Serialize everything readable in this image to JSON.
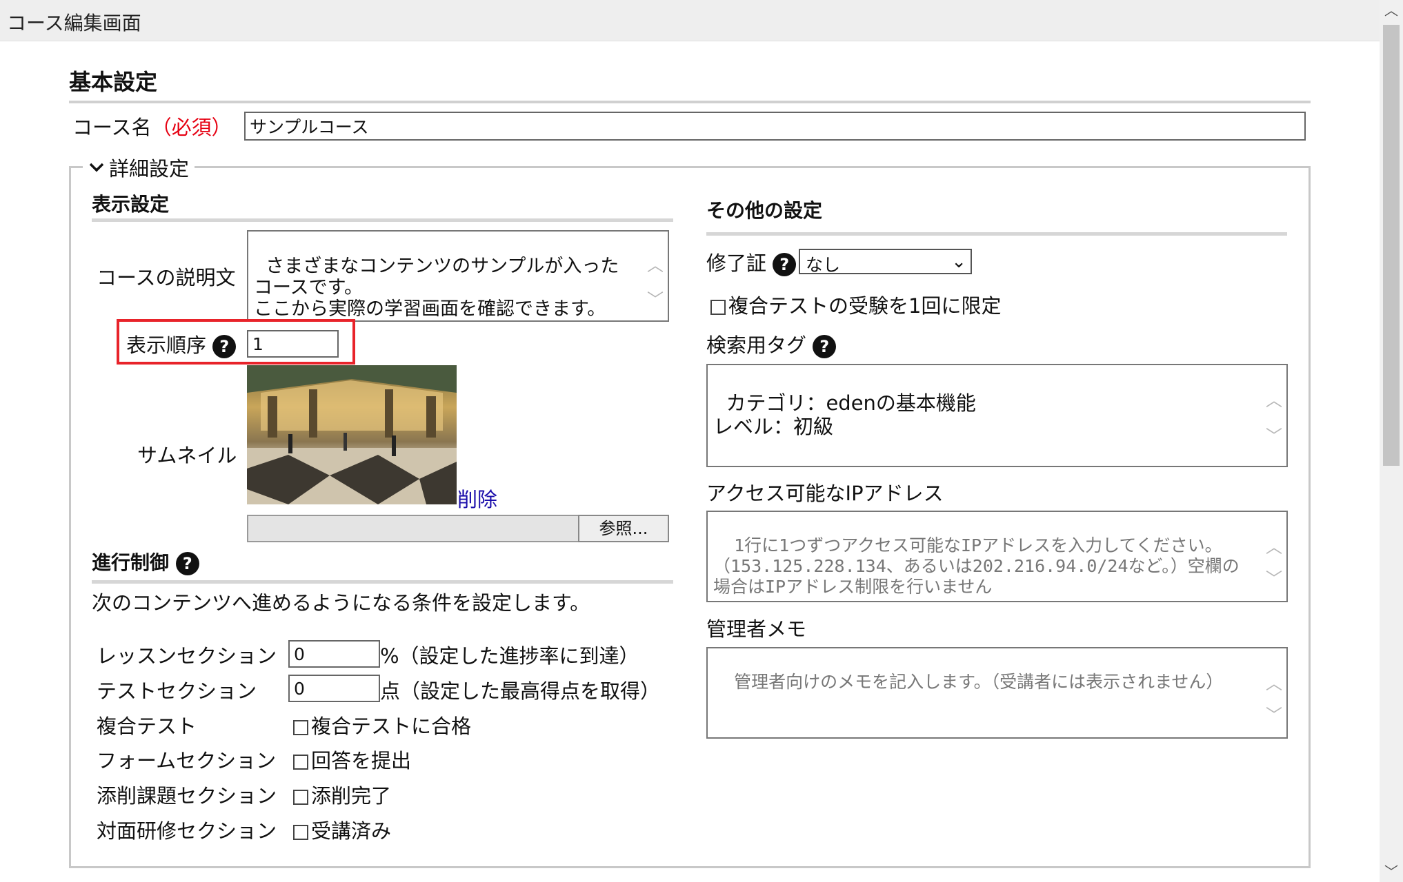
{
  "window": {
    "title": "コース編集画面"
  },
  "basic": {
    "heading": "基本設定",
    "course_name_label": "コース名",
    "required_label": "（必須）",
    "course_name_value": "サンプルコース"
  },
  "details": {
    "legend": "詳細設定",
    "display": {
      "heading": "表示設定",
      "description_label": "コースの説明文",
      "description_value": "さまざまなコンテンツのサンプルが入ったコースです。\nここから実際の学習画面を確認できます。",
      "order_label": "表示順序",
      "order_value": "1",
      "thumbnail_label": "サムネイル",
      "delete_link": "削除",
      "browse_button": "参照..."
    },
    "progress": {
      "heading": "進行制御",
      "description": "次のコンテンツへ進めるようになる条件を設定します。",
      "rows": [
        {
          "label": "レッスンセクション",
          "value": "0",
          "suffix": "%（設定した進捗率に到達）"
        },
        {
          "label": "テストセクション",
          "value": "0",
          "suffix": "点（設定した最高得点を取得）"
        },
        {
          "label": "複合テスト",
          "check": "複合テストに合格"
        },
        {
          "label": "フォームセクション",
          "check": "回答を提出"
        },
        {
          "label": "添削課題セクション",
          "check": "添削完了"
        },
        {
          "label": "対面研修セクション",
          "check": "受講済み"
        }
      ]
    },
    "other": {
      "heading": "その他の設定",
      "certificate_label": "修了証",
      "certificate_value": "なし",
      "limit_label": "複合テストの受験を1回に限定",
      "tags_label": "検索用タグ",
      "tags_value": "カテゴリ：edenの基本機能\nレベル：初級",
      "ip_label": "アクセス可能なIPアドレス",
      "ip_placeholder": "1行に1つずつアクセス可能なIPアドレスを入力してください。（153.125.228.134、あるいは202.216.94.0/24など。）空欄の場合はIPアドレス制限を行いません",
      "memo_label": "管理者メモ",
      "memo_placeholder": "管理者向けのメモを記入します。（受講者には表示されません）"
    }
  },
  "help_glyph": "?",
  "colors": {
    "required": "#e60012",
    "highlight": "#e8232a",
    "link": "#1a0dab"
  }
}
